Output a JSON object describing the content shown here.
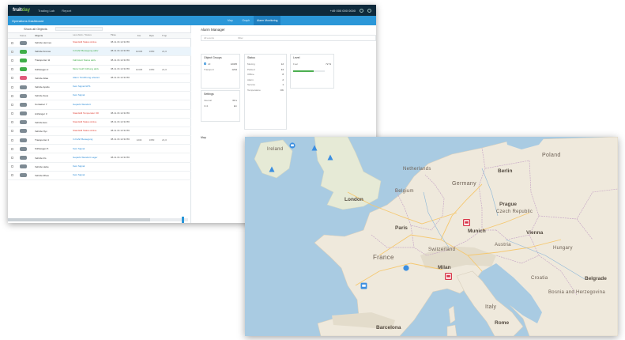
{
  "app": {
    "logo_main": "fruit",
    "logo_accent": "day",
    "nav": [
      "Trading Lab",
      "Report"
    ],
    "user": "+49 000 000 0000",
    "subbar_title": "Operations Dashboard",
    "tabs": [
      "Map",
      "Graph",
      "Alarm Monitoring"
    ],
    "list_header": "Show all Objects",
    "columns": [
      "Status",
      "Objects",
      "Last Aktiv / Status",
      "Time",
      "Km",
      "Rpm",
      "Tmp"
    ],
    "rows": [
      {
        "status": "gray",
        "name": "Vehicle Hermes",
        "act": "Standstill Status Active",
        "act_color": "red",
        "time": "08.11.16 12:34:56",
        "n1": "",
        "n2": "",
        "n3": ""
      },
      {
        "status": "green",
        "name": "Vehicle Kronos",
        "act": "In Fahrt Bewegung aktiv",
        "act_color": "green",
        "time": "08.11.16 12:34:56",
        "n1": "12345",
        "n2": "1650",
        "n3": "21,0"
      },
      {
        "status": "green",
        "name": "Transporter 11",
        "act": "Fahrtstart Status aktiv",
        "act_color": "green",
        "time": "08.11.16 12:34:56",
        "n1": "",
        "n2": "",
        "n3": ""
      },
      {
        "status": "green",
        "name": "Kühlwagen 2",
        "act": "Motor läuft Kühlung aktiv",
        "act_color": "green",
        "time": "08.11.16 12:34:56",
        "n1": "12345",
        "n2": "1650",
        "n3": "21,0"
      },
      {
        "status": "pink",
        "name": "Vehicle Atlas",
        "act": "Alarm Türöffnung erkannt",
        "act_color": "blue",
        "time": "08.11.16 12:34:56",
        "n1": "",
        "n2": "",
        "n3": ""
      },
      {
        "status": "gray",
        "name": "Vehicle Apollo",
        "act": "Kein Signal GPS",
        "act_color": "blue",
        "time": "",
        "n1": "",
        "n2": "",
        "n3": ""
      },
      {
        "status": "gray",
        "name": "Vehicle Zeus",
        "act": "Kein Signal",
        "act_color": "blue",
        "time": "",
        "n1": "",
        "n2": "",
        "n3": ""
      },
      {
        "status": "gray",
        "name": "Container 7",
        "act": "Geparkt Standort",
        "act_color": "blue",
        "time": "",
        "n1": "",
        "n2": "",
        "n3": ""
      },
      {
        "status": "gray",
        "name": "Anhänger 3",
        "act": "Standstill Temperatur OK",
        "act_color": "red",
        "time": "08.11.16 12:34:56",
        "n1": "",
        "n2": "",
        "n3": ""
      },
      {
        "status": "gray",
        "name": "Vehicle Eos",
        "act": "Standstill Status Active",
        "act_color": "red",
        "time": "08.11.16 12:34:56",
        "n1": "",
        "n2": "",
        "n3": ""
      },
      {
        "status": "gray",
        "name": "Vehicle Nyx",
        "act": "Standstill Status Active",
        "act_color": "red",
        "time": "08.11.16 12:34:56",
        "n1": "",
        "n2": "",
        "n3": ""
      },
      {
        "status": "gray",
        "name": "Transporter 4",
        "act": "In Fahrt Bewegung",
        "act_color": "blue",
        "time": "08.11.16 12:34:56",
        "n1": "1234",
        "n2": "1650",
        "n3": "21,0"
      },
      {
        "status": "gray",
        "name": "Kühlwagen 5",
        "act": "Kein Signal",
        "act_color": "blue",
        "time": "",
        "n1": "",
        "n2": "",
        "n3": ""
      },
      {
        "status": "gray",
        "name": "Vehicle Iris",
        "act": "Geparkt Standort Lager",
        "act_color": "blue",
        "time": "08.11.16 12:34:56",
        "n1": "",
        "n2": "",
        "n3": ""
      },
      {
        "status": "gray",
        "name": "Vehicle Hebe",
        "act": "Kein Signal",
        "act_color": "blue",
        "time": "",
        "n1": "",
        "n2": "",
        "n3": ""
      },
      {
        "status": "gray",
        "name": "Vehicle Rhea",
        "act": "Kein Signal",
        "act_color": "blue",
        "time": "",
        "n1": "",
        "n2": "",
        "n3": ""
      }
    ],
    "right_title": "Alarm Manager",
    "filter_a": "All events",
    "filter_b": "Filter",
    "card1": {
      "title": "Object Groups",
      "rows": [
        [
          "All",
          "12345"
        ],
        [
          "Transport",
          "1234"
        ]
      ]
    },
    "card2": {
      "title": "Status",
      "rows": [
        [
          "Moving",
          "12"
        ],
        [
          "Parked",
          "34"
        ],
        [
          "Offline",
          "8"
        ],
        [
          "Alarm",
          "2"
        ],
        [
          "Service",
          "1"
        ],
        [
          "Temperature",
          "OK"
        ]
      ]
    },
    "card3": {
      "title": "Level",
      "rows": [
        [
          "Fuel",
          "72 %"
        ]
      ],
      "progress_percent": 65
    },
    "card4": {
      "title": "Settings",
      "rows": [
        [
          "Interval",
          "60 s"
        ],
        [
          "Unit",
          "km"
        ]
      ]
    },
    "map_section": "Map"
  },
  "map": {
    "labels": {
      "ireland": "Ireland",
      "poland": "Poland",
      "netherlands": "Netherlands",
      "germany": "Germany",
      "belgium": "Belgium",
      "czech": "Czech Republic",
      "france": "France",
      "austria": "Austria",
      "switzerland": "Switzerland",
      "hungary": "Hungary",
      "croatia": "Croatia",
      "bosnia": "Bosnia and Herzegovina",
      "italy": "Italy",
      "london": "London",
      "paris": "Paris",
      "berlin": "Berlin",
      "prague": "Prague",
      "vienna": "Vienna",
      "munich": "Munich",
      "milan": "Milan",
      "rome": "Rome",
      "belgrade": "Belgrade",
      "barcelona": "Barcelona"
    },
    "colors": {
      "land": "#efe9dc",
      "water": "#a9cbe2",
      "pin_blue": "#3b8ee0",
      "pin_red": "#d9374a"
    }
  }
}
